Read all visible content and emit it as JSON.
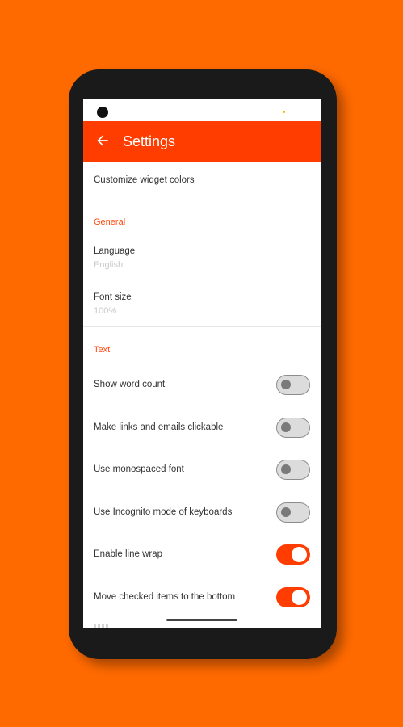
{
  "app_bar": {
    "title": "Settings"
  },
  "items": {
    "customize": "Customize widget colors"
  },
  "general": {
    "header": "General",
    "language_title": "Language",
    "language_value": "English",
    "font_size_title": "Font size",
    "font_size_value": "100%"
  },
  "text": {
    "header": "Text",
    "toggles": [
      {
        "label": "Show word count",
        "enabled": false
      },
      {
        "label": "Make links and emails clickable",
        "enabled": false
      },
      {
        "label": "Use monospaced font",
        "enabled": false
      },
      {
        "label": "Use Incognito mode of keyboards",
        "enabled": false
      },
      {
        "label": "Enable line wrap",
        "enabled": true
      },
      {
        "label": "Move checked items to the bottom",
        "enabled": true
      }
    ]
  },
  "colors": {
    "accent": "#ff3d00",
    "background": "#ff6a00"
  }
}
